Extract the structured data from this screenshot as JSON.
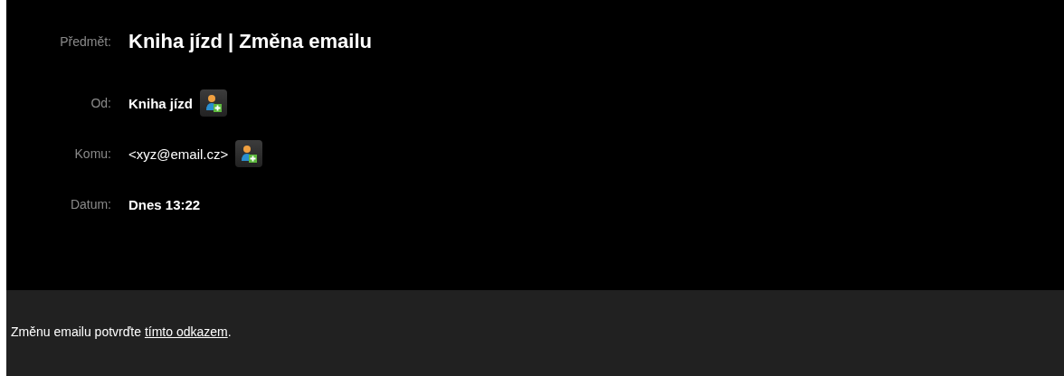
{
  "header": {
    "subject": {
      "label": "Předmět:",
      "value": "Kniha jízd | Změna emailu"
    },
    "fields": [
      {
        "label": "Od:",
        "value": "Kniha jízd",
        "kind": "name",
        "add_contact": true
      },
      {
        "label": "Komu:",
        "value": "<xyz@email.cz>",
        "kind": "address",
        "add_contact": true
      },
      {
        "label": "Datum:",
        "value": "Dnes 13:22",
        "kind": "date",
        "add_contact": false
      }
    ]
  },
  "body": {
    "text_before": "Změnu emailu potvrďte ",
    "link": "tímto odkazem",
    "text_after": "."
  }
}
